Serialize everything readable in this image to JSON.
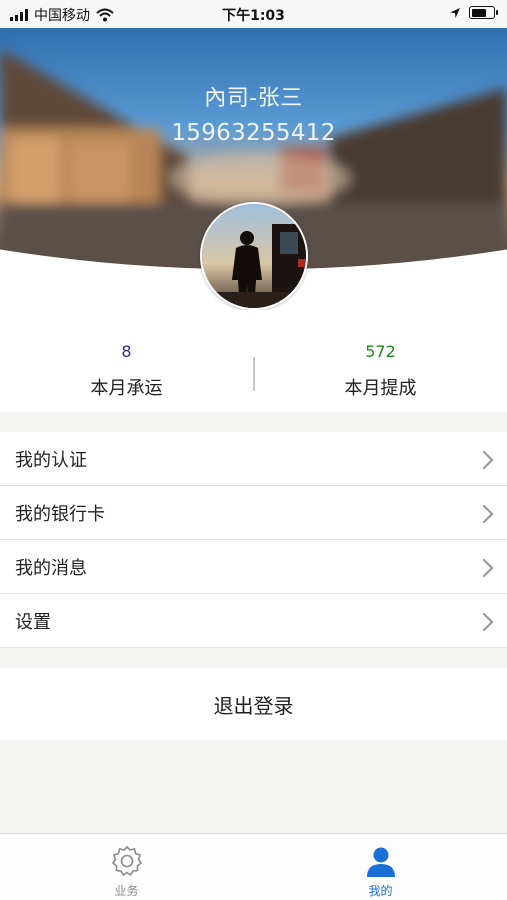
{
  "status_bar": {
    "carrier": "中国移动",
    "time": "下午1:03"
  },
  "profile": {
    "name": "內司-张三",
    "phone": "15963255412"
  },
  "stats": [
    {
      "value": "8",
      "label": "本月承运",
      "color": "#2b2c8c"
    },
    {
      "value": "572",
      "label": "本月提成",
      "color": "#1c8a1c"
    }
  ],
  "menu": [
    {
      "label": "我的认证",
      "icon": "chevron-right-icon"
    },
    {
      "label": "我的银行卡",
      "icon": "chevron-right-icon"
    },
    {
      "label": "我的消息",
      "icon": "chevron-right-icon"
    },
    {
      "label": "设置",
      "icon": "chevron-right-icon"
    }
  ],
  "logout_label": "退出登录",
  "tabbar": {
    "tabs": [
      {
        "label": "业务",
        "icon": "gear-icon",
        "active": false
      },
      {
        "label": "我的",
        "icon": "person-icon",
        "active": true
      }
    ],
    "active_color": "#1a6fd6",
    "inactive_color": "#8a8a8a"
  },
  "colors": {
    "sky": "#3f87c7",
    "header_text": "#f4f6f8"
  }
}
